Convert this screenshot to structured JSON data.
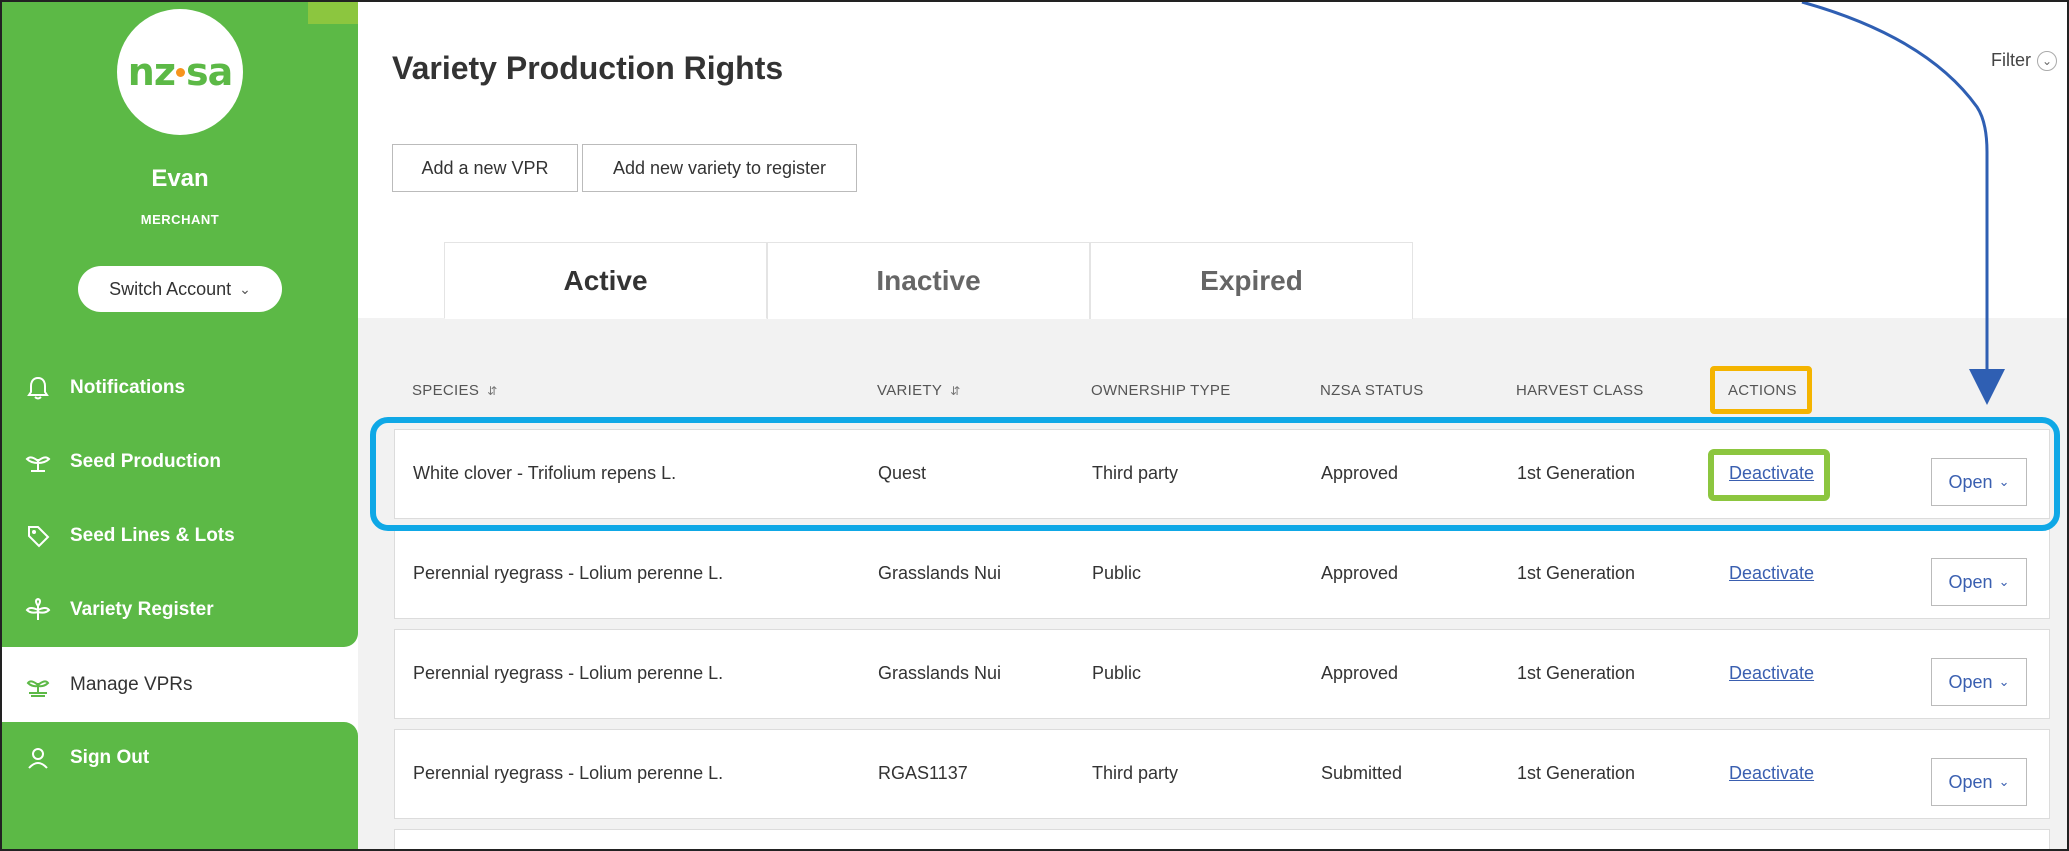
{
  "sidebar": {
    "logo_text": "nzsa",
    "user_name": "Evan",
    "user_role": "MERCHANT",
    "switch_label": "Switch Account",
    "nav": [
      {
        "label": "Notifications",
        "icon": "bell-icon"
      },
      {
        "label": "Seed Production",
        "icon": "plant-icon"
      },
      {
        "label": "Seed Lines & Lots",
        "icon": "tag-icon"
      },
      {
        "label": "Variety Register",
        "icon": "sprout-icon"
      },
      {
        "label": "Manage VPRs",
        "icon": "seedling-icon"
      },
      {
        "label": "Sign Out",
        "icon": "user-icon"
      }
    ]
  },
  "header": {
    "title": "Variety Production Rights",
    "filter_label": "Filter"
  },
  "toolbar": {
    "add_vpr": "Add a new VPR",
    "add_variety": "Add new variety to register"
  },
  "tabs": [
    "Active",
    "Inactive",
    "Expired"
  ],
  "table": {
    "columns": [
      "SPECIES",
      "VARIETY",
      "OWNERSHIP TYPE",
      "NZSA STATUS",
      "HARVEST CLASS",
      "ACTIONS"
    ],
    "rows": [
      {
        "species": "White clover - Trifolium repens L.",
        "variety": "Quest",
        "ownership": "Third party",
        "status": "Approved",
        "harvest": "1st Generation",
        "action": "Deactivate",
        "open": "Open"
      },
      {
        "species": "Perennial ryegrass - Lolium perenne L.",
        "variety": "Grasslands Nui",
        "ownership": "Public",
        "status": "Approved",
        "harvest": "1st Generation",
        "action": "Deactivate",
        "open": "Open"
      },
      {
        "species": "Perennial ryegrass - Lolium perenne L.",
        "variety": "Grasslands Nui",
        "ownership": "Public",
        "status": "Approved",
        "harvest": "1st Generation",
        "action": "Deactivate",
        "open": "Open"
      },
      {
        "species": "Perennial ryegrass - Lolium perenne L.",
        "variety": "RGAS1137",
        "ownership": "Third party",
        "status": "Submitted",
        "harvest": "1st Generation",
        "action": "Deactivate",
        "open": "Open"
      }
    ]
  },
  "colors": {
    "brand_green": "#5cb946",
    "highlight_blue": "#0fa8e6",
    "highlight_orange": "#f4b400",
    "highlight_green": "#8cc63f",
    "arrow_blue": "#2f5fb3",
    "link_blue": "#3a5fb0"
  }
}
